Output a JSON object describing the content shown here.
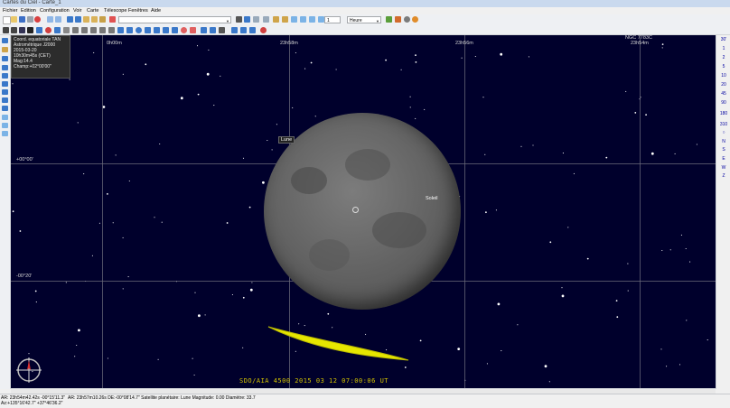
{
  "window": {
    "title": "Cartes du Ciel - Carte_1"
  },
  "menu": [
    "Fichier",
    "Edition",
    "Configuration",
    "Voir",
    "Carte",
    "Télescope",
    "Fenêtres",
    "Aide"
  ],
  "toolbar": {
    "field_combo_value": "",
    "step_value": "1",
    "step_unit": "Heure"
  },
  "info": {
    "line1": "Coord. equatoriale TAN",
    "line2": "Astrométrique J2000",
    "line3": "2015-03-20",
    "line4": "10h30m45s (CET)",
    "line5": "Mag:14.4",
    "line6": "Champ:+02°00'00\""
  },
  "ra_labels": [
    "0h00m",
    "23h58m",
    "23h56m",
    "23h54m"
  ],
  "dec_labels": [
    "+00°00'",
    "-00°20'"
  ],
  "top_right_label": "NGC 7783C",
  "objects": {
    "moon": "Lune",
    "sun": "Soleil"
  },
  "time_stamp": "SDO/AIA 4500   2015 03 12 07:00:06 UT",
  "right_panel": [
    "30'",
    "1",
    "2",
    "5",
    "10",
    "20",
    "45",
    "90",
    "180",
    "310",
    "○",
    "N",
    "S",
    "E",
    "W",
    "Z"
  ],
  "status": {
    "cursor_radec": "AR: 23h54m42.42s -00°15'11.3\"",
    "cursor_altaz": "Az:+135°16'42.7\" +37°46'36.2\"",
    "object_info": "AR: 23h57m10.26s DE:-00°08'14.7\"  Satellite planétaire: Lune  Magnitude: 0.00  Diamètre: 33.7"
  },
  "colors": {
    "sky": "#00002c",
    "moon": "#6d6d6d",
    "eclipse_sun": "#e6e600"
  }
}
